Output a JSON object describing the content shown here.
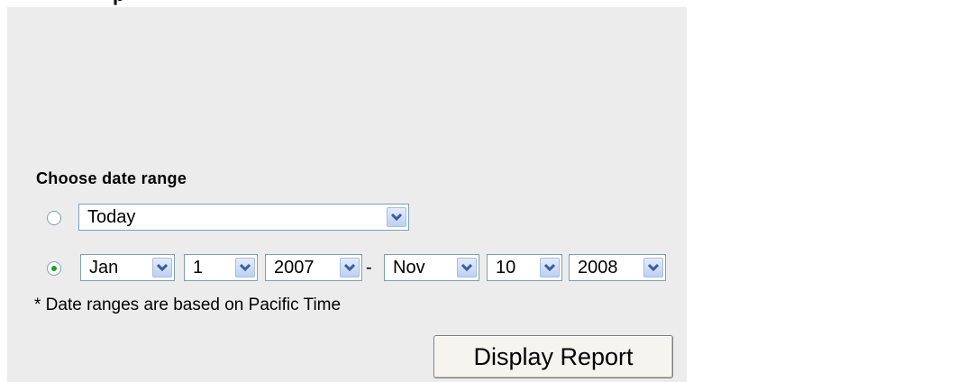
{
  "header": {
    "title_fragment": "p"
  },
  "date_range": {
    "heading": "Choose date range",
    "preset": {
      "selected": "Today"
    },
    "custom": {
      "start_month": "Jan",
      "start_day": "1",
      "start_year": "2007",
      "separator": "-",
      "end_month": "Nov",
      "end_day": "10",
      "end_year": "2008"
    },
    "selected_option": "custom",
    "note": "* Date ranges are based on Pacific Time"
  },
  "actions": {
    "display_report_label": "Display Report"
  },
  "icons": {
    "dropdown": "chevron-down-icon"
  },
  "colors": {
    "panel_background": "#ececec",
    "radio_selected": "#20a020",
    "select_border": "#7f9db9"
  }
}
